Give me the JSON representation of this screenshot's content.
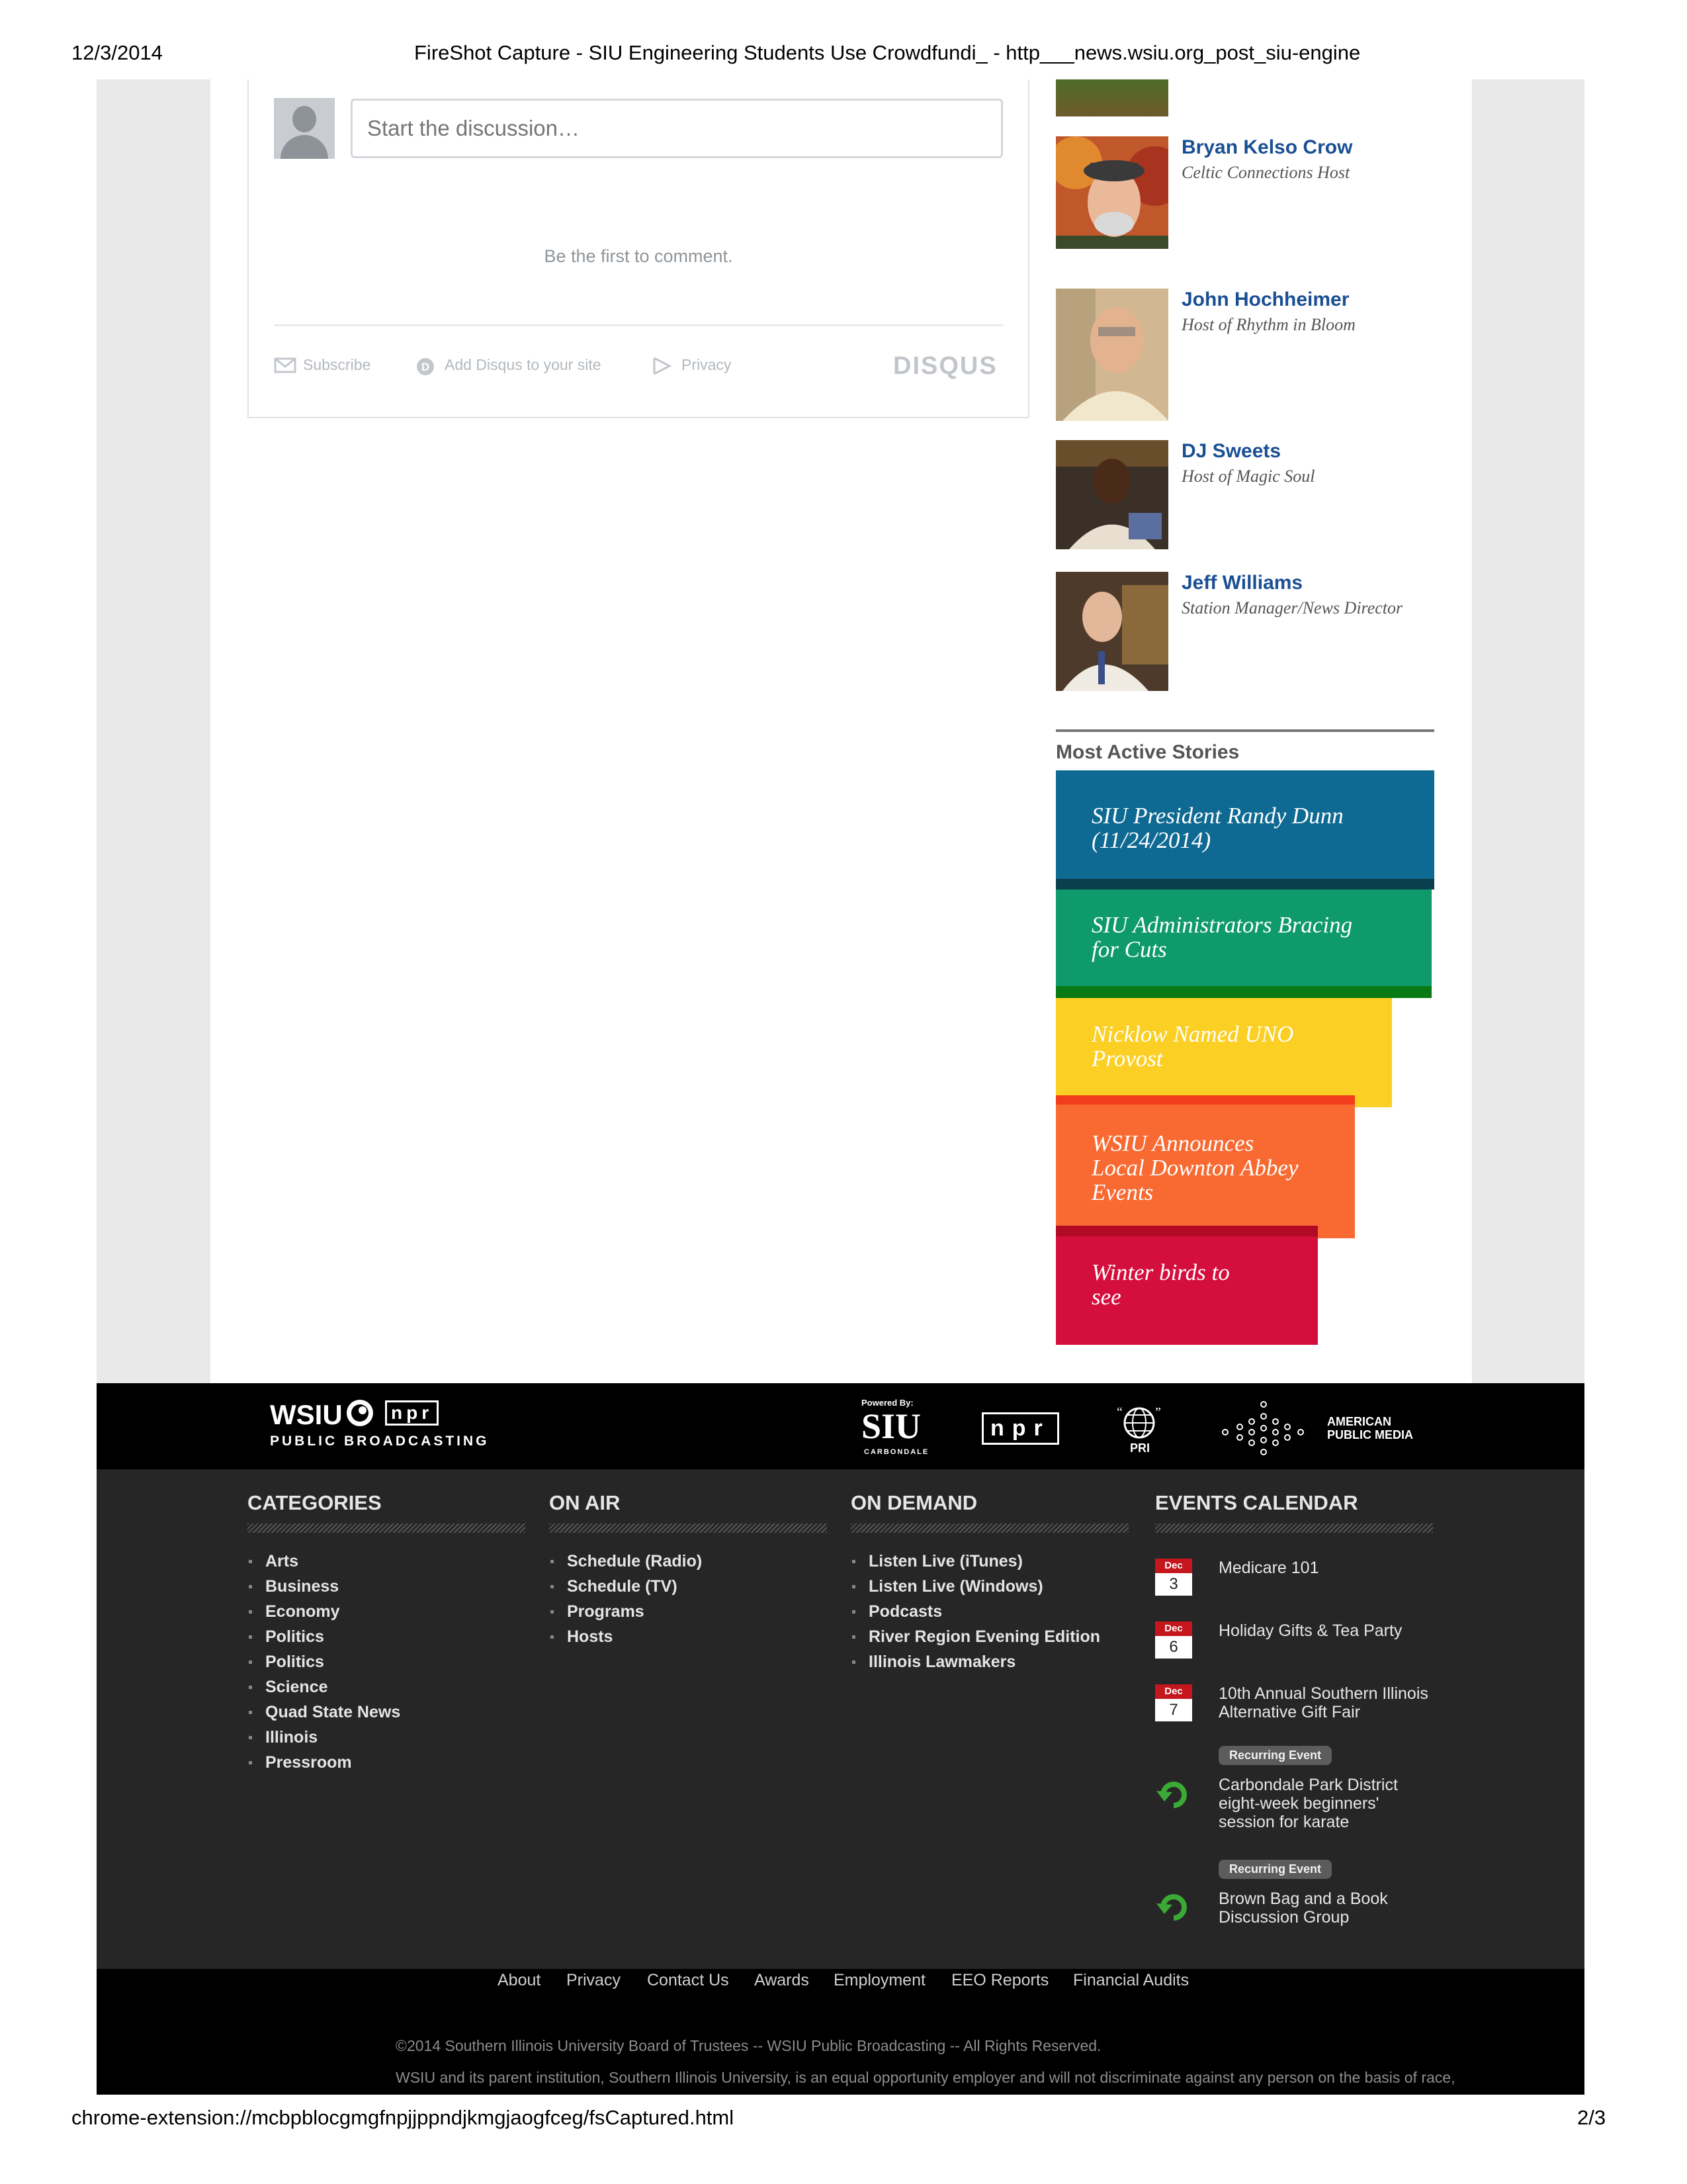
{
  "print_header": {
    "date": "12/3/2014",
    "title": "FireShot Capture - SIU Engineering Students Use Crowdfundi_ - http___news.wsiu.org_post_siu-engine"
  },
  "print_footer": {
    "url": "chrome-extension://mcbpblocgmgfnpjjppndjkmgjaogfceg/fsCaptured.html",
    "page": "2/3"
  },
  "disqus": {
    "input_placeholder": "Start the discussion…",
    "empty_message": "Be the first to comment.",
    "subscribe_label": "Subscribe",
    "add_disqus_label": "Add Disqus to your site",
    "privacy_label": "Privacy",
    "logo": "DISQUS"
  },
  "hosts": [
    {
      "name": "Bryan Kelso Crow",
      "role": "Celtic Connections Host"
    },
    {
      "name": "John Hochheimer",
      "role": "Host of Rhythm in Bloom"
    },
    {
      "name": "DJ Sweets",
      "role": "Host of Magic Soul"
    },
    {
      "name": "Jeff Williams",
      "role": "Station Manager/News Director"
    }
  ],
  "most_active": {
    "title": "Most Active Stories",
    "stories": [
      {
        "line1": "SIU President Randy Dunn",
        "line2": "(11/24/2014)",
        "line3": "",
        "color": "#0f6a93"
      },
      {
        "line1": "SIU Administrators Bracing",
        "line2": "for Cuts",
        "line3": "",
        "color": "#0e9a6a"
      },
      {
        "line1": "Nicklow Named UNO",
        "line2": "Provost",
        "line3": "",
        "color": "#fccf24"
      },
      {
        "line1": "WSIU Announces",
        "line2": "Local Downton Abbey",
        "line3": "Events",
        "color": "#f86a32"
      },
      {
        "line1": "Winter birds to",
        "line2": "see",
        "line3": "",
        "color": "#d50f3d"
      }
    ]
  },
  "footer_logos": {
    "wsiu": "WSIU",
    "npr_small": "npr",
    "public_broadcasting": "PUBLIC BROADCASTING",
    "powered_by": "Powered By:",
    "siu": "SIU",
    "carbondale": "CARBONDALE",
    "npr": "npr",
    "pri": "PRI",
    "apm_line1": "AMERICAN",
    "apm_line2": "PUBLIC MEDIA"
  },
  "footer_columns": {
    "categories": {
      "title": "CATEGORIES",
      "items": [
        "Arts",
        "Business",
        "Economy",
        "Politics",
        "Politics",
        "Science",
        "Quad State News",
        "Illinois",
        "Pressroom"
      ]
    },
    "on_air": {
      "title": "ON AIR",
      "items": [
        "Schedule (Radio)",
        "Schedule (TV)",
        "Programs",
        "Hosts"
      ]
    },
    "on_demand": {
      "title": "ON DEMAND",
      "items": [
        "Listen Live (iTunes)",
        "Listen Live (Windows)",
        "Podcasts",
        "River Region Evening Edition",
        "Illinois Lawmakers"
      ]
    },
    "events": {
      "title": "EVENTS CALENDAR",
      "dated": [
        {
          "month": "Dec",
          "day": "3",
          "line1": "Medicare 101",
          "line2": ""
        },
        {
          "month": "Dec",
          "day": "6",
          "line1": "Holiday Gifts & Tea Party",
          "line2": ""
        },
        {
          "month": "Dec",
          "day": "7",
          "line1": "10th Annual Southern Illinois",
          "line2": "Alternative Gift Fair"
        }
      ],
      "recurring": [
        {
          "badge": "Recurring Event",
          "line1": "Carbondale Park District",
          "line2": "eight-week beginners'",
          "line3": "session for karate"
        },
        {
          "badge": "Recurring Event",
          "line1": "Brown Bag and a Book",
          "line2": "Discussion Group",
          "line3": ""
        }
      ]
    }
  },
  "footer_links": [
    "About",
    "Privacy",
    "Contact Us",
    "Awards",
    "Employment",
    "EEO Reports",
    "Financial Audits"
  ],
  "copyright": {
    "line1": "©2014 Southern Illinois University Board of Trustees -- WSIU Public Broadcasting -- All Rights Reserved.",
    "line2": "WSIU and its parent institution, Southern Illinois University, is an equal opportunity employer and will not discriminate against any person on the basis of race,"
  }
}
